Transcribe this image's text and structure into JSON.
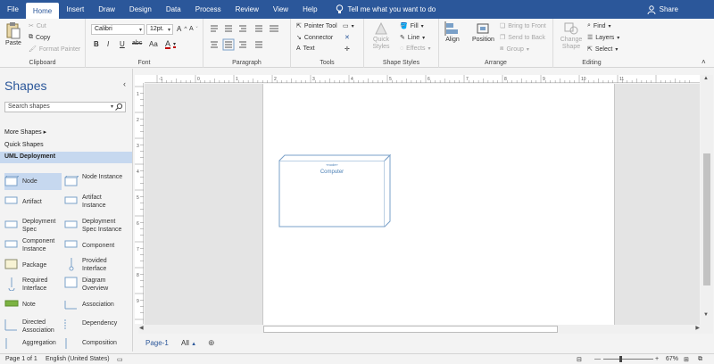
{
  "menu": {
    "tabs": [
      "File",
      "Home",
      "Insert",
      "Draw",
      "Design",
      "Data",
      "Process",
      "Review",
      "View",
      "Help"
    ],
    "active": "Home",
    "tell_me": "Tell me what you want to do",
    "share": "Share"
  },
  "ribbon": {
    "clipboard": {
      "label": "Clipboard",
      "paste": "Paste",
      "cut": "Cut",
      "copy": "Copy",
      "format_painter": "Format Painter"
    },
    "font": {
      "label": "Font",
      "font_name": "Calibri",
      "font_size": "12pt.",
      "bold": "B",
      "italic": "I",
      "underline": "U",
      "strike": "abc",
      "case": "Aa",
      "grow": "A",
      "shrink": "A",
      "color": "A"
    },
    "paragraph": {
      "label": "Paragraph"
    },
    "tools": {
      "label": "Tools",
      "pointer": "Pointer Tool",
      "connector": "Connector",
      "text": "Text"
    },
    "shape_styles": {
      "label": "Shape Styles",
      "quick_styles": "Quick Styles",
      "fill": "Fill",
      "line": "Line",
      "effects": "Effects"
    },
    "arrange": {
      "label": "Arrange",
      "align": "Align",
      "position": "Position",
      "bring_front": "Bring to Front",
      "send_back": "Send to Back",
      "group": "Group"
    },
    "editing": {
      "label": "Editing",
      "change_shape": "Change Shape",
      "find": "Find",
      "layers": "Layers",
      "select": "Select"
    }
  },
  "shapes_panel": {
    "title": "Shapes",
    "search_placeholder": "Search shapes",
    "more_shapes": "More Shapes",
    "quick_shapes": "Quick Shapes",
    "stencil_name": "UML Deployment",
    "items": [
      {
        "label": "Node"
      },
      {
        "label": "Node Instance"
      },
      {
        "label": "Artifact"
      },
      {
        "label": "Artifact Instance"
      },
      {
        "label": "Deployment Spec"
      },
      {
        "label": "Deployment Spec Instance"
      },
      {
        "label": "Component Instance"
      },
      {
        "label": "Component"
      },
      {
        "label": "Package"
      },
      {
        "label": "Provided Interface"
      },
      {
        "label": "Required Interface"
      },
      {
        "label": "Diagram Overview"
      },
      {
        "label": "Note"
      },
      {
        "label": "Association"
      },
      {
        "label": "Directed Association"
      },
      {
        "label": "Dependency"
      },
      {
        "label": "Aggregation"
      },
      {
        "label": "Composition"
      }
    ]
  },
  "rulers": {
    "top_labels": [
      "-1",
      "0",
      "1",
      "2",
      "3",
      "4",
      "5",
      "6",
      "7",
      "8",
      "9",
      "10",
      "11"
    ],
    "left_labels": [
      "1",
      "2",
      "3",
      "4",
      "5",
      "6",
      "7",
      "8",
      "9"
    ]
  },
  "canvas": {
    "node_stereotype": "«node»",
    "node_name": "Computer"
  },
  "page_tabs": {
    "page": "Page-1",
    "all": "All"
  },
  "status": {
    "page": "Page 1 of 1",
    "language": "English (United States)",
    "zoom": "67%"
  },
  "colors": {
    "accent": "#2b579a",
    "selection": "#c6d8ef",
    "shape_stroke": "#7aa0c8"
  }
}
